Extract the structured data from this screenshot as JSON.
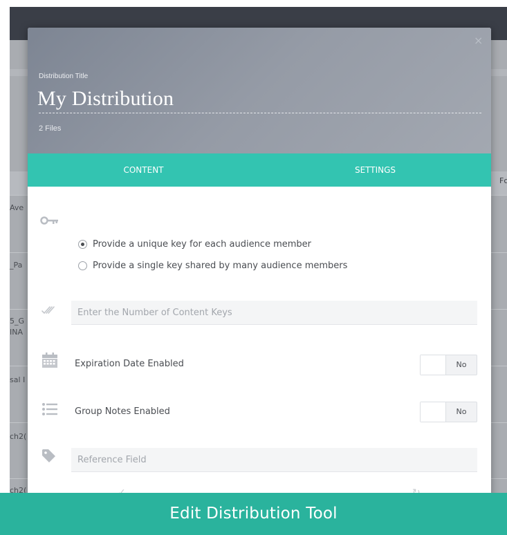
{
  "background": {
    "column_header": "Fc",
    "row_labels": [
      "Ave",
      "_Pa",
      "5_G",
      "INA",
      "sal I",
      "ch2(",
      "ch2("
    ]
  },
  "modal": {
    "close_glyph": "×",
    "title_label": "Distribution Title",
    "title": "My Distribution",
    "files_count": "2 Files",
    "tabs": [
      {
        "label": "CONTENT",
        "active": true
      },
      {
        "label": "SETTINGS",
        "active": false
      }
    ],
    "key_options": [
      {
        "label": "Provide a unique key for each audience member",
        "checked": true
      },
      {
        "label": "Provide a single key shared by many audience members",
        "checked": false
      }
    ],
    "content_keys": {
      "placeholder": "Enter the Number of Content Keys",
      "value": ""
    },
    "expiration": {
      "label": "Expiration Date Enabled",
      "toggle_label": "No",
      "enabled": false
    },
    "group_notes": {
      "label": "Group Notes Enabled",
      "toggle_label": "No",
      "enabled": false
    },
    "reference": {
      "placeholder": "Reference Field",
      "value": ""
    },
    "icons": {
      "key": "key-icon",
      "check": "double-check-icon",
      "calendar": "calendar-icon",
      "list": "list-icon",
      "tag": "tag-icon"
    }
  },
  "caption": "Edit Distribution Tool",
  "colors": {
    "accent": "#33c4b1",
    "caption_bg": "#2ab39d",
    "header_gradient_start": "#7d8593",
    "header_gradient_end": "#a3a8b1"
  }
}
